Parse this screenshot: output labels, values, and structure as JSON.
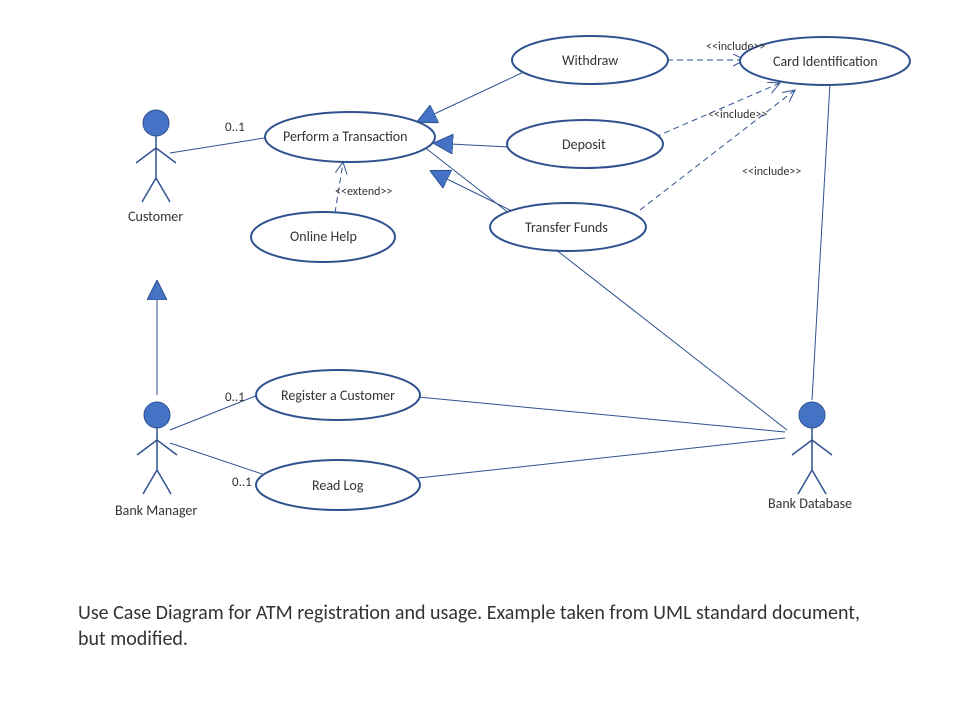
{
  "actors": {
    "customer": "Customer",
    "bank_manager": "Bank Manager",
    "bank_database": "Bank Database"
  },
  "usecases": {
    "perform_transaction": "Perform  a Transaction",
    "online_help": "Online Help",
    "withdraw": "Withdraw",
    "deposit": "Deposit",
    "transfer_funds": "Transfer Funds",
    "card_identification": "Card Identification",
    "register_customer": "Register a Customer",
    "read_log": "Read Log"
  },
  "multiplicities": {
    "m01": "0..1"
  },
  "stereotypes": {
    "extend": "<<extend>>",
    "include": "<<include>>"
  },
  "caption": "Use Case Diagram for ATM registration and usage. Example taken from UML standard document, but modified."
}
